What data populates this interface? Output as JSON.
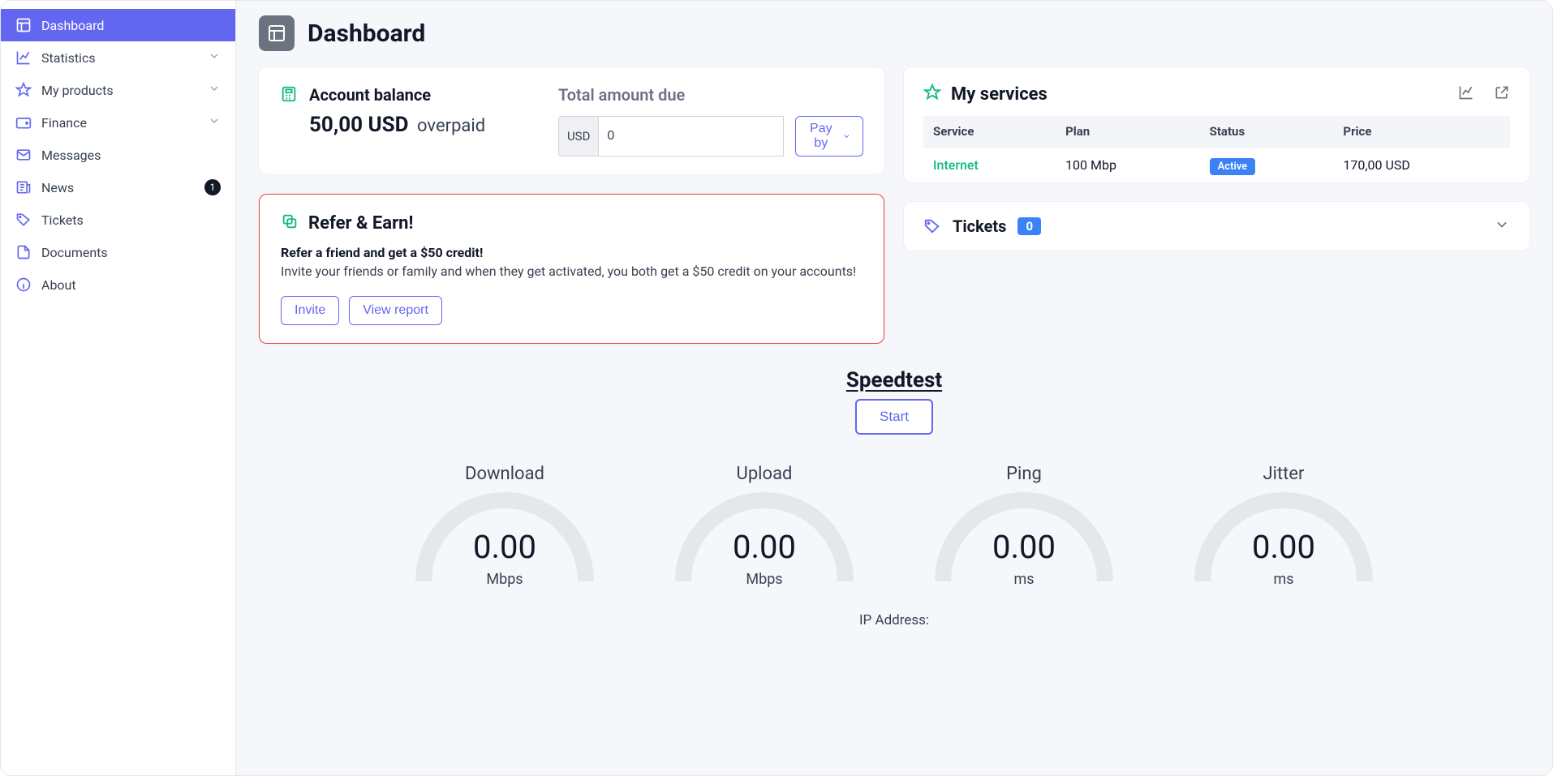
{
  "page": {
    "title": "Dashboard"
  },
  "sidebar": {
    "items": [
      {
        "label": "Dashboard"
      },
      {
        "label": "Statistics"
      },
      {
        "label": "My products"
      },
      {
        "label": "Finance"
      },
      {
        "label": "Messages"
      },
      {
        "label": "News",
        "badge": "1"
      },
      {
        "label": "Tickets"
      },
      {
        "label": "Documents"
      },
      {
        "label": "About"
      }
    ]
  },
  "balance": {
    "title": "Account balance",
    "amount": "50,00 USD",
    "overpaid_label": "overpaid",
    "due_title": "Total amount due",
    "currency": "USD",
    "amount_input": "0",
    "payby_label": "Pay by"
  },
  "refer": {
    "title": "Refer & Earn!",
    "headline": "Refer a friend and get a $50 credit!",
    "body": "Invite your friends or family and when they get activated, you both get a $50 credit on your accounts!",
    "invite_label": "Invite",
    "report_label": "View report"
  },
  "services": {
    "title": "My services",
    "cols": {
      "service": "Service",
      "plan": "Plan",
      "status": "Status",
      "price": "Price"
    },
    "rows": [
      {
        "service": "Internet",
        "plan": "100 Mbp",
        "status": "Active",
        "price": "170,00 USD"
      }
    ]
  },
  "tickets": {
    "title": "Tickets",
    "count": "0"
  },
  "speedtest": {
    "title": "Speedtest",
    "start_label": "Start",
    "gauges": [
      {
        "label": "Download",
        "value": "0.00",
        "unit": "Mbps"
      },
      {
        "label": "Upload",
        "value": "0.00",
        "unit": "Mbps"
      },
      {
        "label": "Ping",
        "value": "0.00",
        "unit": "ms"
      },
      {
        "label": "Jitter",
        "value": "0.00",
        "unit": "ms"
      }
    ],
    "ip_label": "IP Address:"
  }
}
